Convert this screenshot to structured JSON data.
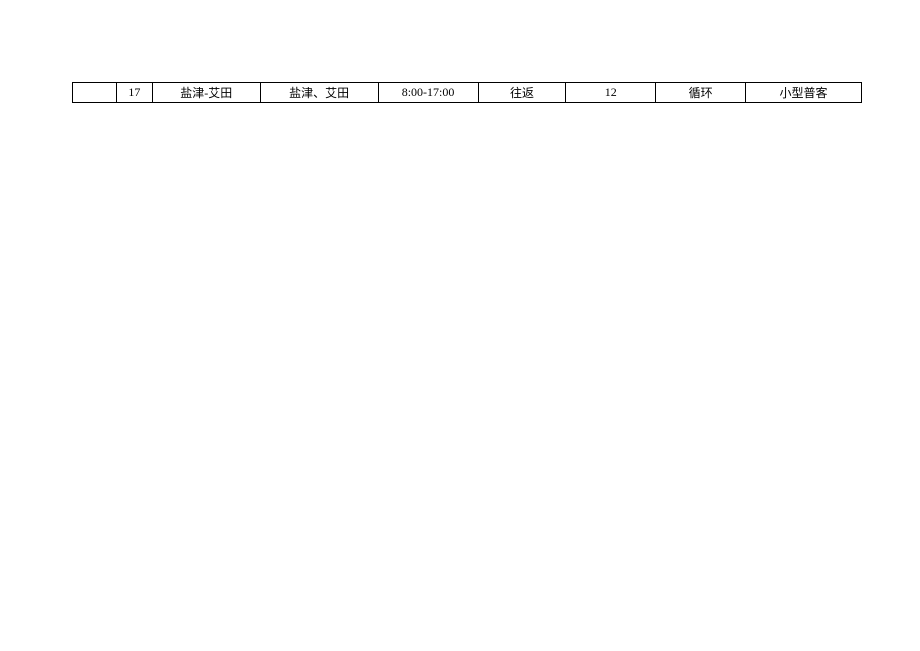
{
  "rows": [
    {
      "c0": "",
      "c1": "17",
      "c2": "盐津-艾田",
      "c3": "盐津、艾田",
      "c4": "8:00-17:00",
      "c5": "往返",
      "c6": "12",
      "c7": "循环",
      "c8": "小型普客"
    }
  ]
}
